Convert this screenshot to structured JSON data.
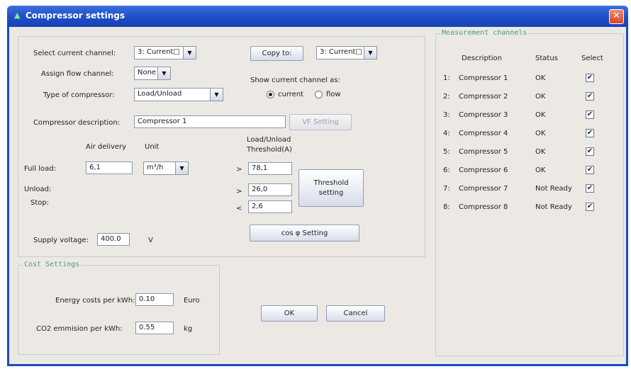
{
  "window": {
    "title": "Compressor settings",
    "close_glyph": "✕",
    "title_icon": "arrow-up-icon"
  },
  "main": {
    "select_channel_label": "Select current channel:",
    "select_channel_value": "3: Current□",
    "copy_to_label": "Copy to:",
    "copy_to_value": "3: Current□",
    "assign_flow_label": "Assign flow channel:",
    "assign_flow_value": "None",
    "show_as_label": "Show current channel as:",
    "radio_current": "current",
    "radio_flow": "flow",
    "type_label": "Type of compressor:",
    "type_value": "Load/Unload",
    "desc_label": "Compressor description:",
    "desc_value": "Compressor 1",
    "vf_button": "VF Setting",
    "air_delivery_header": "Air delivery",
    "unit_header": "Unit",
    "threshold_header_1": "Load/Unload",
    "threshold_header_2": "Threshold(A)",
    "full_load_label": "Full load:",
    "full_load_value": "6,1",
    "unit_value": "m³/h",
    "unload_label": "Unload:",
    "stop_label": "Stop:",
    "op_full": ">",
    "op_unload": ">",
    "op_stop": "<",
    "thr_full": "78,1",
    "thr_unload": "26,0",
    "thr_stop": "2,6",
    "threshold_button": "Threshold setting",
    "supply_label": "Supply voltage:",
    "supply_value": "400.0",
    "supply_unit": "V",
    "cos_button": "cos φ Setting"
  },
  "cost": {
    "legend": "Cost Settings",
    "energy_label": "Energy costs per kWh:",
    "energy_value": "0.10",
    "energy_unit": "Euro",
    "co2_label": "CO2 emmision per kWh:",
    "co2_value": "0.55",
    "co2_unit": "kg"
  },
  "actions": {
    "ok": "OK",
    "cancel": "Cancel"
  },
  "channels": {
    "legend": "Measurement channels",
    "col_description": "Description",
    "col_status": "Status",
    "col_select": "Select",
    "rows": [
      {
        "index": "1:",
        "name": "Compressor 1",
        "status": "OK",
        "selected": true
      },
      {
        "index": "2:",
        "name": "Compressor 2",
        "status": "OK",
        "selected": true
      },
      {
        "index": "3:",
        "name": "Compressor 3",
        "status": "OK",
        "selected": true
      },
      {
        "index": "4:",
        "name": "Compressor 4",
        "status": "OK",
        "selected": true
      },
      {
        "index": "5:",
        "name": "Compressor 5",
        "status": "OK",
        "selected": true
      },
      {
        "index": "6:",
        "name": "Compressor 6",
        "status": "OK",
        "selected": true
      },
      {
        "index": "7:",
        "name": "Compressor 7",
        "status": "Not Ready",
        "selected": true
      },
      {
        "index": "8:",
        "name": "Compressor 8",
        "status": "Not Ready",
        "selected": true
      }
    ],
    "check_glyph": "✔"
  },
  "colors": {
    "titlebar": "#1c4cc4",
    "legend_text": "#4b9b7c",
    "client_bg": "#ece9e4"
  }
}
